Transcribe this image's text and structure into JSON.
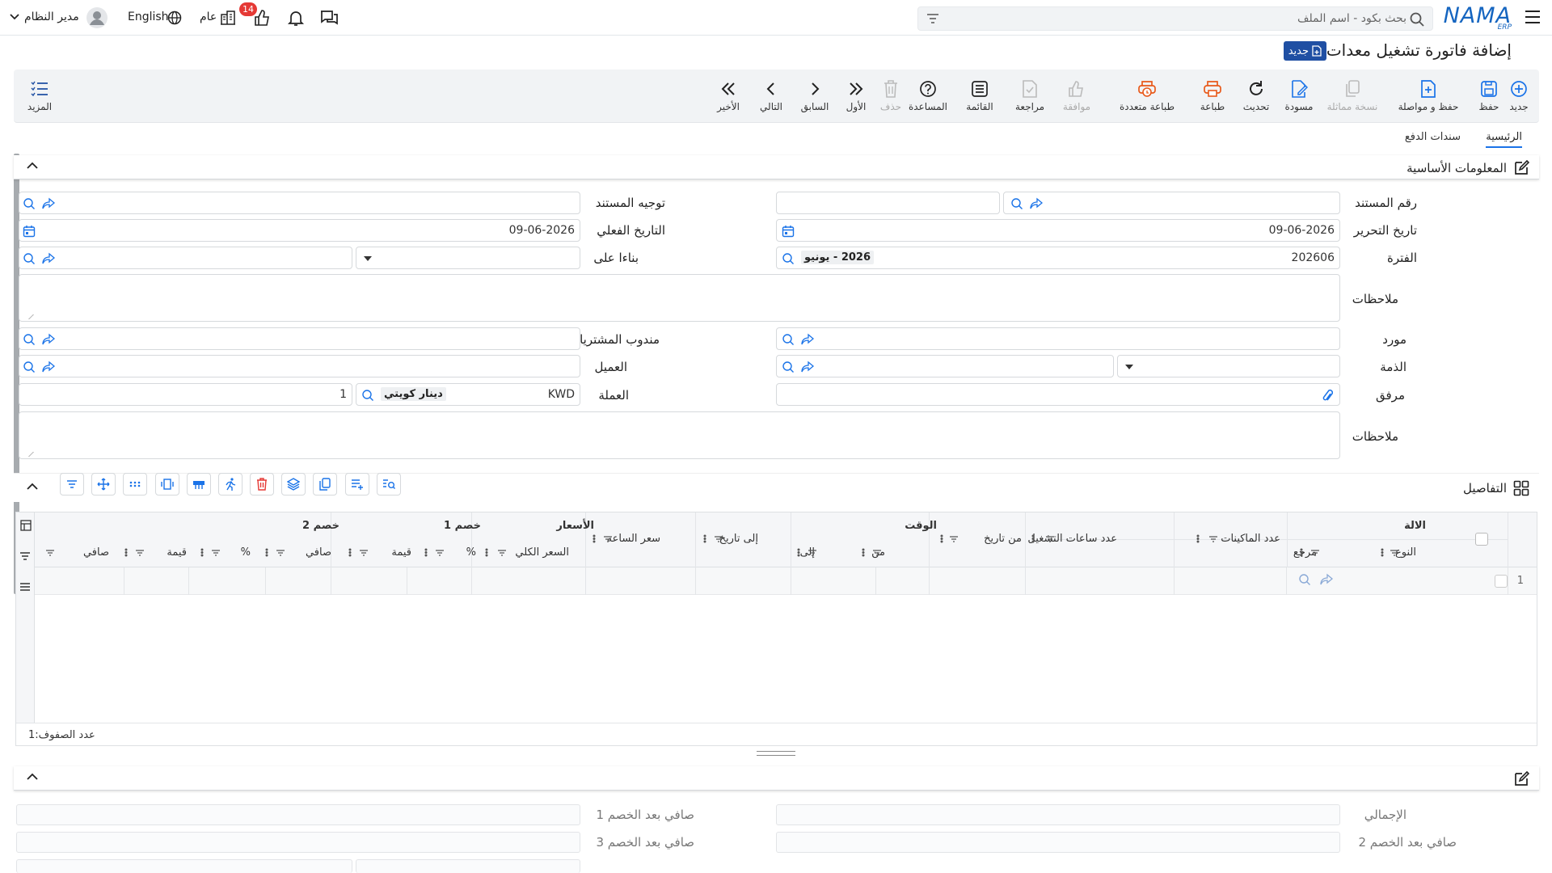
{
  "topbar": {
    "brand": "NAMA",
    "brand_sub": "ERP",
    "search_placeholder": "بحث بكود - اسم الملف",
    "user_name": "مدير النظام",
    "language": "English",
    "branch": "عام",
    "notif_count": "14"
  },
  "page": {
    "title": "إضافة فاتورة تشغيل معدات",
    "new_tag": "جديد"
  },
  "toolbar": {
    "new": "جديد",
    "save": "حفظ",
    "save_continue": "حفظ و مواصلة",
    "copy": "نسخة مماثلة",
    "draft": "مسودة",
    "refresh": "تحديث",
    "print": "طباعة",
    "multi_print": "طباعة متعددة",
    "approve": "موافقة",
    "review": "مراجعة",
    "list": "القائمة",
    "help": "المساعدة",
    "delete": "حذف",
    "first": "الأول",
    "prev": "السابق",
    "next": "التالي",
    "last": "الأخير",
    "more": "المزيد"
  },
  "tabs": {
    "main": "الرئيسية",
    "payments": "سندات الدفع"
  },
  "basic": {
    "title": "المعلومات الأساسية",
    "doc_number": "رقم المستند",
    "doc_direction": "توجيه المستند",
    "edit_date": "تاريخ التحرير",
    "edit_date_value": "09-06-2026",
    "actual_date": "التاريخ الفعلي",
    "actual_date_value": "09-06-2026",
    "period": "الفترة",
    "period_value": "202606",
    "period_name": "2026 - يونيو",
    "based_on": "بناءا على",
    "notes": "ملاحظات",
    "supplier": "مورد",
    "purchasing_rep": "مندوب المشتريات",
    "account": "الذمة",
    "customer": "العميل",
    "attachment": "مرفق",
    "currency": "العملة",
    "currency_code": "KWD",
    "currency_name": "دينار كويتي",
    "currency_rate": "1",
    "notes2": "ملاحظات"
  },
  "details": {
    "title": "التفاصيل",
    "group_machine": "الالة",
    "group_time": "الوقت",
    "group_prices": "الأسعار",
    "group_disc1": "خصم 1",
    "group_disc2": "خصم 2",
    "col_type": "النوع",
    "col_ref": "مرجع",
    "col_machines": "عدد الماكينات",
    "col_hours": "عدد ساعات التشغيل",
    "col_from_date": "من تاريخ",
    "col_from": "من",
    "col_to": "إلى",
    "col_to_date": "إلى تاريخ",
    "col_hour_price": "سعر الساعة",
    "col_total_price": "السعر الكلي",
    "col_pct": "%",
    "col_value": "قيمة",
    "col_net": "صافي",
    "row_number": "1",
    "row_count_label": "عدد الصفوف:",
    "row_count": "1"
  },
  "summary": {
    "total": "الإجمالي",
    "net_after_disc1": "صافي بعد الخصم 1",
    "net_after_disc2": "صافي بعد الخصم 2",
    "net_after_disc3": "صافي بعد الخصم 3"
  },
  "colors": {
    "accent": "#1a73e8",
    "brand": "#1565c0",
    "danger": "#e53935",
    "print": "#e8591a",
    "tag": "#1f4fa3"
  }
}
